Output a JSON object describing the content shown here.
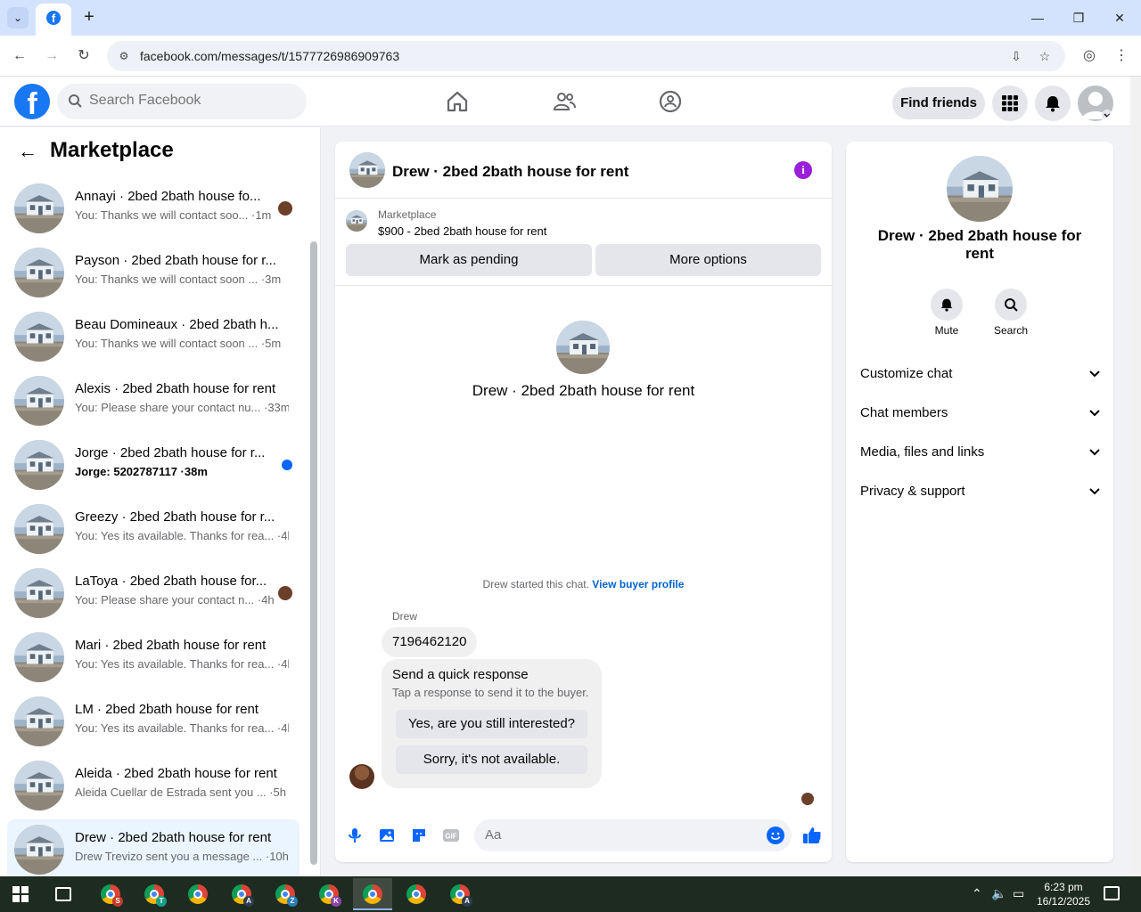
{
  "browser": {
    "url": "facebook.com/messages/t/1577726986909763",
    "new_tab": "+",
    "minimize": "—",
    "maximize": "❐",
    "close": "✕"
  },
  "header": {
    "search_placeholder": "Search Facebook",
    "find_friends": "Find friends"
  },
  "sidebar": {
    "title": "Marketplace",
    "conversations": [
      {
        "name": "Annayi · 2bed 2bath house fo...",
        "preview": "You: Thanks we will contact soo... ·1m",
        "indicator": "avatar"
      },
      {
        "name": "Payson · 2bed 2bath house for r...",
        "preview": "You: Thanks we will contact soon ... ·3m",
        "indicator": ""
      },
      {
        "name": "Beau Domineaux · 2bed 2bath h...",
        "preview": "You: Thanks we will contact soon ... ·5m",
        "indicator": ""
      },
      {
        "name": "Alexis · 2bed 2bath house for rent",
        "preview": "You: Please share your contact nu... ·33m",
        "indicator": ""
      },
      {
        "name": "Jorge · 2bed 2bath house for r...",
        "preview": "Jorge: 5202787117 ·38m",
        "indicator": "unread"
      },
      {
        "name": "Greezy · 2bed 2bath house for r...",
        "preview": "You: Yes its available. Thanks for rea... ·4h",
        "indicator": ""
      },
      {
        "name": "LaToya · 2bed 2bath house for...",
        "preview": "You: Please share your contact n... ·4h",
        "indicator": "avatar"
      },
      {
        "name": "Mari · 2bed 2bath house for rent",
        "preview": "You: Yes its available. Thanks for rea... ·4h",
        "indicator": ""
      },
      {
        "name": "LM · 2bed 2bath house for rent",
        "preview": "You: Yes its available. Thanks for rea... ·4h",
        "indicator": ""
      },
      {
        "name": "Aleida · 2bed 2bath house for rent",
        "preview": "Aleida Cuellar de Estrada sent you ... ·5h",
        "indicator": ""
      },
      {
        "name": "Drew · 2bed 2bath house for rent",
        "preview": "Drew Trevizo sent you a message ... ·10h",
        "indicator": ""
      }
    ]
  },
  "chat": {
    "title": "Drew · 2bed 2bath house for rent",
    "marketplace_label": "Marketplace",
    "listing": "$900 - 2bed 2bath house for rent",
    "mark_pending": "Mark as pending",
    "more_options": "More options",
    "intro_title": "Drew · 2bed 2bath house for rent",
    "started_text": "Drew started this chat.",
    "started_link": "View buyer profile",
    "sender_name": "Drew",
    "message": "7196462120",
    "quick_title": "Send a quick response",
    "quick_sub": "Tap a response to send it to the buyer.",
    "quick_opt1": "Yes, are you still interested?",
    "quick_opt2": "Sorry, it's not available.",
    "input_placeholder": "Aa"
  },
  "details": {
    "title": "Drew · 2bed 2bath house for rent",
    "mute": "Mute",
    "search": "Search",
    "rows": [
      "Customize chat",
      "Chat members",
      "Media, files and links",
      "Privacy & support"
    ]
  },
  "taskbar": {
    "time": "6:23 pm",
    "date": "16/12/2025",
    "badges": [
      "S",
      "T",
      "",
      "A",
      "Z",
      "K",
      "",
      "",
      "A"
    ]
  },
  "colors": {
    "accent": "#0866ff",
    "info": "#9a1fd9",
    "active_row": "#ebf5ff"
  }
}
